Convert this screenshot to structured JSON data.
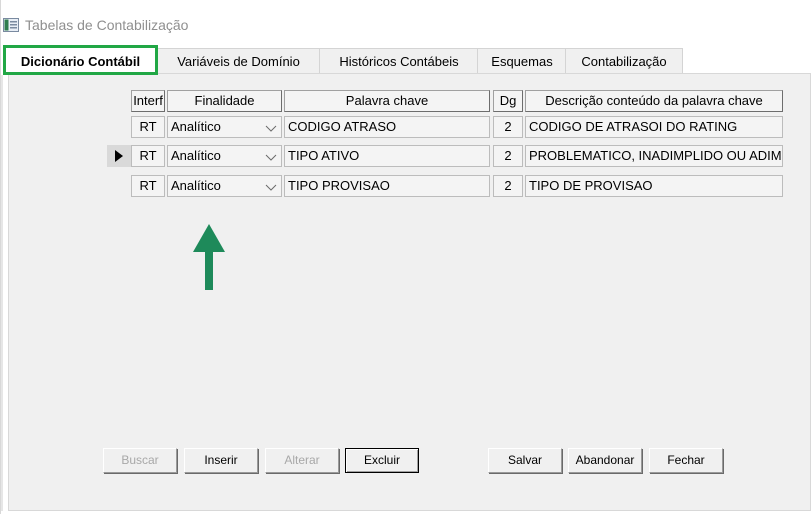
{
  "window": {
    "title": "Tabelas de Contabilização"
  },
  "tabs": [
    {
      "label": "Dicionário Contábil",
      "active": true
    },
    {
      "label": "Variáveis de Domínio"
    },
    {
      "label": "Históricos Contábeis"
    },
    {
      "label": "Esquemas"
    },
    {
      "label": "Contabilização"
    }
  ],
  "grid": {
    "columns": [
      "Interf",
      "Finalidade",
      "Palavra chave",
      "Dg",
      "Descrição conteúdo da palavra chave"
    ],
    "rows": [
      {
        "interf": "RT",
        "finalidade": "Analítico",
        "palavra": "CODIGO ATRASO",
        "dg": "2",
        "descricao": "CODIGO DE ATRASOI DO RATING",
        "current": false
      },
      {
        "interf": "RT",
        "finalidade": "Analítico",
        "palavra": "TIPO ATIVO",
        "dg": "2",
        "descricao": "PROBLEMATICO, INADIMPLIDO OU ADIM",
        "current": true
      },
      {
        "interf": "RT",
        "finalidade": "Analítico",
        "palavra": "TIPO PROVISAO",
        "dg": "2",
        "descricao": "TIPO DE PROVISAO",
        "current": false
      }
    ]
  },
  "buttons": {
    "buscar": "Buscar",
    "inserir": "Inserir",
    "alterar": "Alterar",
    "excluir": "Excluir",
    "salvar": "Salvar",
    "abandonar": "Abandonar",
    "fechar": "Fechar"
  },
  "colors": {
    "highlight": "#21a745",
    "annotation_arrow": "#1e8a5a"
  },
  "icons": {
    "app": "window-app-icon",
    "combo": "chevron-down-icon",
    "row": "row-pointer-icon",
    "annotation": "up-arrow-annotation"
  }
}
